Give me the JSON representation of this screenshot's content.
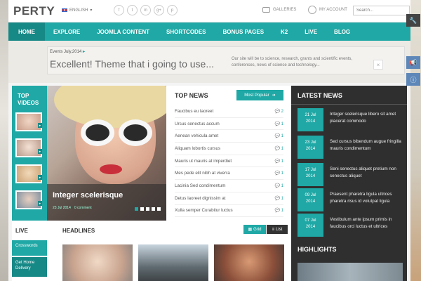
{
  "header": {
    "logo": "PERTY",
    "language": "ENGLISH",
    "socials": [
      "f",
      "t",
      "in",
      "g+",
      "p"
    ],
    "galleries": "GALLERIES",
    "account": "MY ACCOUNT",
    "search_placeholder": "Search..."
  },
  "nav": [
    "HOME",
    "EXPLORE",
    "JOOMLA CONTENT",
    "SHORTCODES",
    "BONUS PAGES",
    "K2",
    "LIVE",
    "BLOG"
  ],
  "ticker": {
    "label": "Events",
    "date": "July,2014",
    "title": "Excellent! Theme that i going to use...",
    "description": "Our site will be to science, research, grants and scientific events, conferences, news of science and technology...",
    "close": "×"
  },
  "top_videos": {
    "title_line1": "TOP",
    "title_line2": "VIDEOS",
    "arrow": "▸"
  },
  "feature": {
    "title": "Integer scelerisque",
    "date": "23 Jul 2014",
    "comments": "0 comment"
  },
  "top_news": {
    "title": "TOP NEWS",
    "popular_label": "Most Popular",
    "items": [
      {
        "title": "Faucibus eu laoreet",
        "count": "2"
      },
      {
        "title": "Ursus senectus accum",
        "count": "1"
      },
      {
        "title": "Aenean vehicula amet",
        "count": "1"
      },
      {
        "title": "Aliquam lobortis cursus",
        "count": "1"
      },
      {
        "title": "Mauris ut mauris at imperdiet",
        "count": "1"
      },
      {
        "title": "Mes pede elit nibh at viverra",
        "count": "1"
      },
      {
        "title": "Lacinia Sed condimentum",
        "count": "1"
      },
      {
        "title": "Detus laoreet dignissim at",
        "count": "1"
      },
      {
        "title": "Xulla semper Curabitur luctus",
        "count": "1"
      }
    ]
  },
  "latest_news": {
    "title": "LATEST NEWS",
    "items": [
      {
        "day": "21 Jul",
        "year": "2014",
        "text": "Integer scelerisque libero sit amet placerat commodo"
      },
      {
        "day": "23 Jul",
        "year": "2014",
        "text": "Sed cursus bibendum augue fringilla mauris condimentum"
      },
      {
        "day": "17 Jul",
        "year": "2014",
        "text": "Seni senectus aliquet pretium non senectus aliquet"
      },
      {
        "day": "09 Jul",
        "year": "2014",
        "text": "Praesent pharetra ligula ultrices pharetra risus id volutpat ligula"
      },
      {
        "day": "07 Jul",
        "year": "2014",
        "text": "Vestibulum ante ipsum primis in faucibus orci luctus et ultrices"
      }
    ],
    "highlights": "HIGHLIGHTS"
  },
  "live": {
    "title": "LIVE",
    "items": [
      "Crosswords",
      "Get Home Delivery"
    ]
  },
  "headlines": {
    "title": "HEADLINES",
    "grid": "Grid",
    "list": "List"
  }
}
